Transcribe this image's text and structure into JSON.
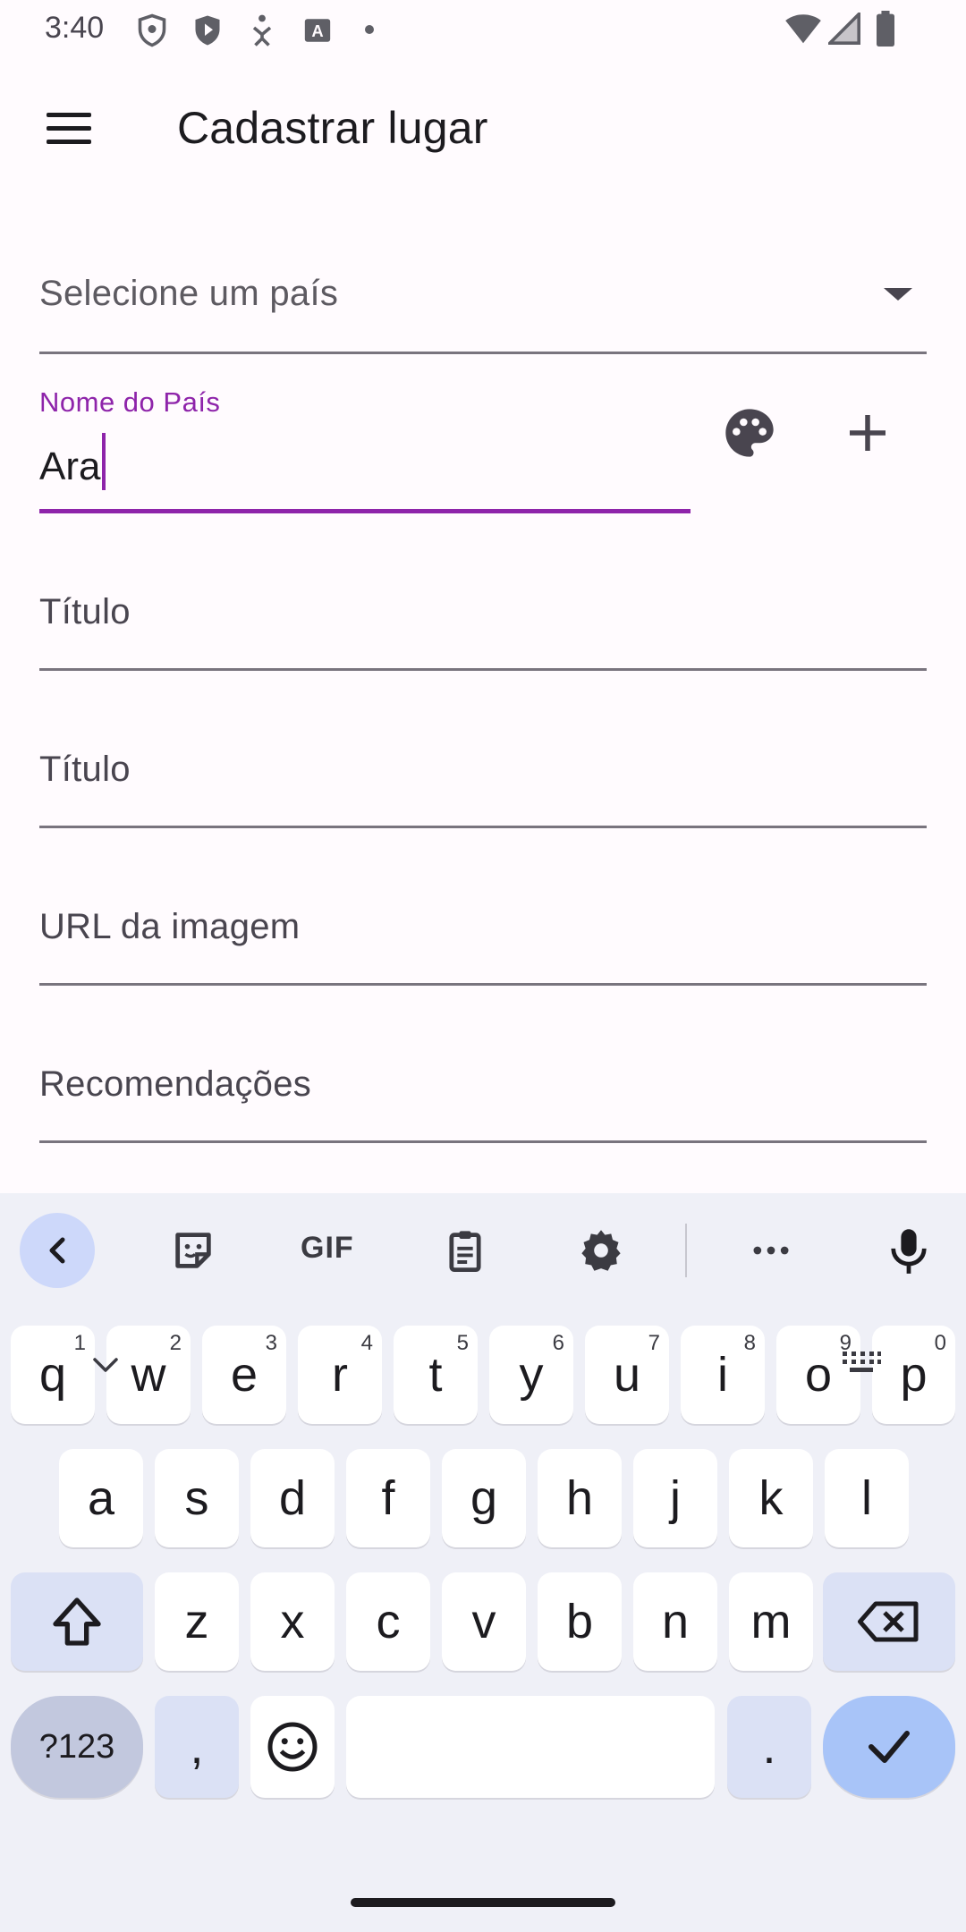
{
  "status_bar": {
    "time": "3:40",
    "icons": [
      "shield-outline-icon",
      "shield-play-icon",
      "accessibility-icon",
      "keyboard-a-icon",
      "dot-icon",
      "wifi-icon",
      "signal-icon",
      "battery-icon"
    ]
  },
  "app_bar": {
    "menu_icon": "hamburger-menu-icon",
    "title": "Cadastrar lugar"
  },
  "form": {
    "country_select": {
      "placeholder": "Selecione um país",
      "icon": "dropdown-arrow-icon"
    },
    "country_name": {
      "label": "Nome do País",
      "value": "Ara"
    },
    "palette_icon": "palette-icon",
    "add_icon": "plus-icon",
    "fields": [
      {
        "label": "Título"
      },
      {
        "label": "Título"
      },
      {
        "label": "URL da imagem"
      },
      {
        "label": "Recomendações"
      }
    ]
  },
  "colors": {
    "accent": "#8e24aa",
    "background": "#fffbfe",
    "keyboard_bg": "#eff0f7",
    "enter_key": "#a8c4f8"
  },
  "keyboard": {
    "toolbar": [
      "collapse-icon",
      "sticker-icon",
      "gif-icon",
      "clipboard-icon",
      "settings-icon",
      "more-icon",
      "mic-icon"
    ],
    "gif_label": "GIF",
    "row1": [
      {
        "key": "q",
        "hint": "1"
      },
      {
        "key": "w",
        "hint": "2"
      },
      {
        "key": "e",
        "hint": "3"
      },
      {
        "key": "r",
        "hint": "4"
      },
      {
        "key": "t",
        "hint": "5"
      },
      {
        "key": "y",
        "hint": "6"
      },
      {
        "key": "u",
        "hint": "7"
      },
      {
        "key": "i",
        "hint": "8"
      },
      {
        "key": "o",
        "hint": "9"
      },
      {
        "key": "p",
        "hint": "0"
      }
    ],
    "row2": [
      "a",
      "s",
      "d",
      "f",
      "g",
      "h",
      "j",
      "k",
      "l"
    ],
    "row3": [
      "z",
      "x",
      "c",
      "v",
      "b",
      "n",
      "m"
    ],
    "symbols_label": "?123",
    "comma": ",",
    "period": "."
  }
}
